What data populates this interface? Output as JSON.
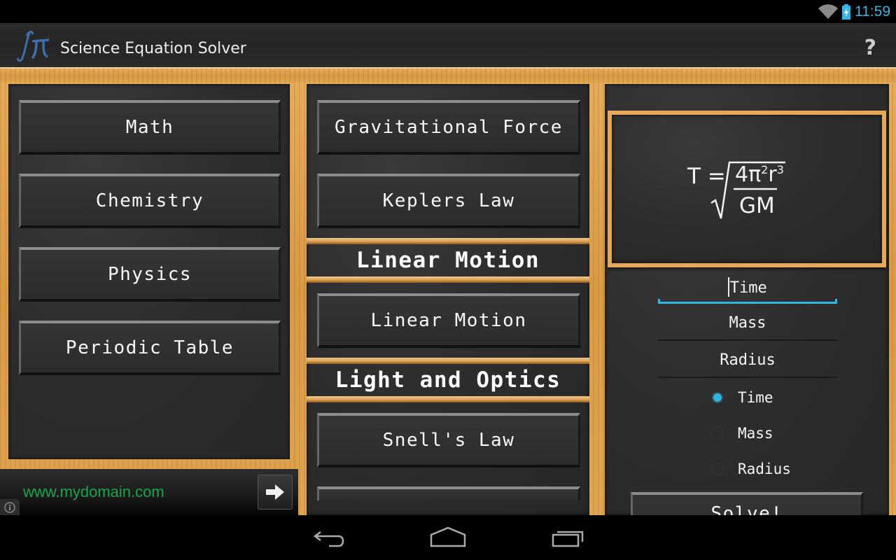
{
  "status_bar": {
    "time": "11:59",
    "icons": [
      "wifi-icon",
      "battery-charging-icon"
    ],
    "accent_color": "#33b5e5"
  },
  "action_bar": {
    "app_title": "Science Equation Solver",
    "logo_icon": "integral-pi-logo",
    "help_label": "?"
  },
  "categories": {
    "items": [
      {
        "label": "Math"
      },
      {
        "label": "Chemistry"
      },
      {
        "label": "Physics"
      },
      {
        "label": "Periodic Table"
      }
    ]
  },
  "equations": {
    "items": [
      {
        "type": "button",
        "label": "Gravitational Force"
      },
      {
        "type": "button",
        "label": "Keplers Law"
      },
      {
        "type": "header",
        "label": "Linear Motion"
      },
      {
        "type": "button",
        "label": "Linear Motion"
      },
      {
        "type": "header",
        "label": "Light and Optics"
      },
      {
        "type": "button",
        "label": "Snell's Law"
      }
    ]
  },
  "solver": {
    "formula": {
      "lhs": "T =",
      "numerator": "4π²r³",
      "numerator_base": "4π",
      "numerator_exp1": "2",
      "numerator_var": "r",
      "numerator_exp2": "3",
      "denominator": "GM"
    },
    "fields": [
      {
        "placeholder": "Time",
        "active": true
      },
      {
        "placeholder": "Mass",
        "active": false
      },
      {
        "placeholder": "Radius",
        "active": false
      }
    ],
    "solve_for": {
      "options": [
        "Time",
        "Mass",
        "Radius"
      ],
      "selected": "Time"
    },
    "solve_label": "Solve!"
  },
  "ad": {
    "url_text": "www.mydomain.com",
    "url_color": "#1aa34a"
  },
  "nav_bar": {
    "buttons": [
      "back-icon",
      "home-icon",
      "recent-apps-icon"
    ]
  }
}
